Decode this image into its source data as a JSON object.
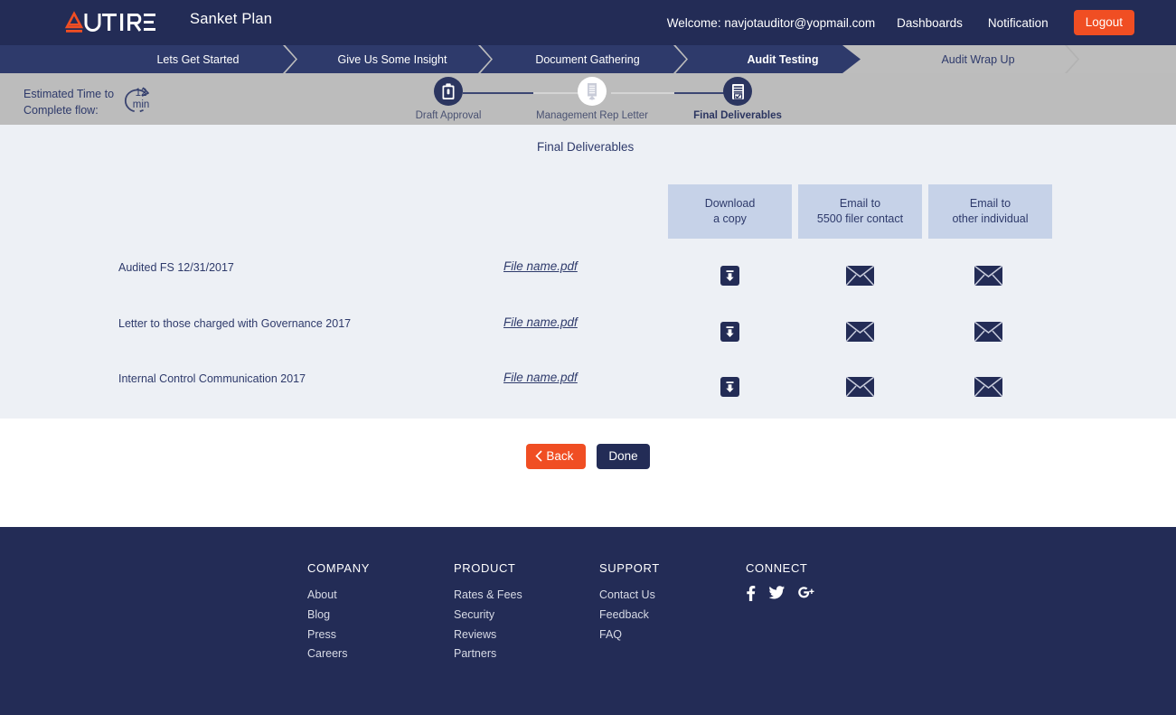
{
  "header": {
    "logo_text": "AUTIRE",
    "plan_name": "Sanket Plan",
    "welcome": "Welcome: navjotauditor@yopmail.com",
    "dashboards_label": "Dashboards",
    "notification_label": "Notification",
    "logout_label": "Logout",
    "bar_color": "#232c56",
    "accent_color": "#f04e23"
  },
  "steps": [
    {
      "label": "Lets Get Started",
      "active": true
    },
    {
      "label": "Give Us Some Insight",
      "active": true
    },
    {
      "label": "Document Gathering",
      "active": true
    },
    {
      "label": "Audit Testing",
      "active": true
    },
    {
      "label": "Audit Wrap Up",
      "active": false
    }
  ],
  "substep": {
    "est_label_line1": "Estimated Time to",
    "est_label_line2": "Complete flow:",
    "est_value": "12",
    "est_unit": "min",
    "nodes": [
      {
        "label": "Draft Approval",
        "icon": "clipboard-icon",
        "state": "done"
      },
      {
        "label": "Management Rep Letter",
        "icon": "document-icon",
        "state": "pending"
      },
      {
        "label": "Final Deliverables",
        "icon": "checklist-icon",
        "state": "current"
      }
    ]
  },
  "main": {
    "title": "Final Deliverables",
    "columns": [
      {
        "line1": "Download",
        "line2": "a copy"
      },
      {
        "line1": "Email to",
        "line2": "5500 filer contact"
      },
      {
        "line1": "Email to",
        "line2": "other individual"
      }
    ],
    "rows": [
      {
        "name": "Audited FS 12/31/2017",
        "file": "File name.pdf"
      },
      {
        "name": "Letter to those charged with Governance 2017",
        "file": "File name.pdf"
      },
      {
        "name": "Internal Control Communication 2017",
        "file": "File name.pdf"
      }
    ],
    "back_label": "Back",
    "done_label": "Done"
  },
  "footer": {
    "columns": [
      {
        "title": "COMPANY",
        "links": [
          "About",
          "Blog",
          "Press",
          "Careers"
        ]
      },
      {
        "title": "PRODUCT",
        "links": [
          "Rates & Fees",
          "Security",
          "Reviews",
          "Partners"
        ]
      },
      {
        "title": "SUPPORT",
        "links": [
          "Contact Us",
          "Feedback",
          "FAQ"
        ]
      },
      {
        "title": "CONNECT",
        "links": []
      }
    ],
    "socials": [
      "facebook-icon",
      "twitter-icon",
      "google-plus-icon"
    ]
  }
}
